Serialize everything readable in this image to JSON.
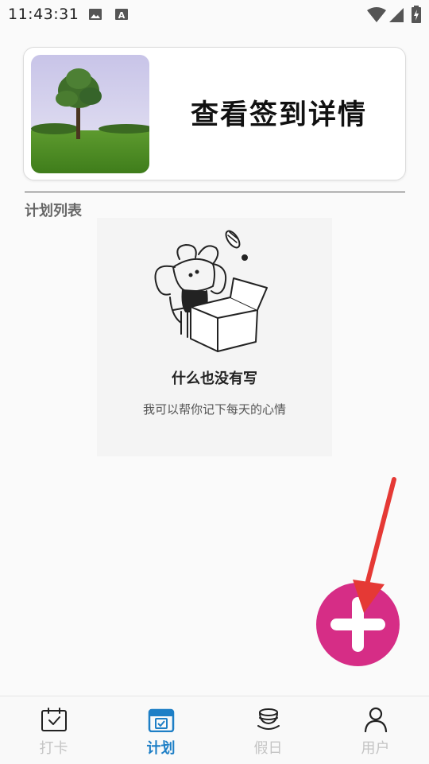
{
  "status_bar": {
    "time": "11:43:31",
    "icons": [
      "image-icon",
      "a-icon",
      "wifi-icon",
      "signal-icon",
      "battery-icon"
    ]
  },
  "card": {
    "title": "查看签到详情",
    "image": "tree-landscape-photo"
  },
  "section": {
    "label": "计划列表"
  },
  "empty_state": {
    "title": "什么也没有写",
    "subtitle": "我可以帮你记下每天的心情",
    "illustration": "bunny-with-box"
  },
  "fab": {
    "icon": "plus-icon",
    "color": "#d62d86"
  },
  "annotation": {
    "color": "#e53935",
    "icon": "arrow-icon"
  },
  "tabs": [
    {
      "label": "打卡",
      "icon": "calendar-check-icon",
      "active": false
    },
    {
      "label": "计划",
      "icon": "calendar-plan-icon",
      "active": true
    },
    {
      "label": "假日",
      "icon": "cup-icon",
      "active": false
    },
    {
      "label": "用户",
      "icon": "user-icon",
      "active": false
    }
  ],
  "colors": {
    "accent": "#1e7fc6",
    "inactive": "#c4c4c4",
    "fab": "#d62d86"
  }
}
